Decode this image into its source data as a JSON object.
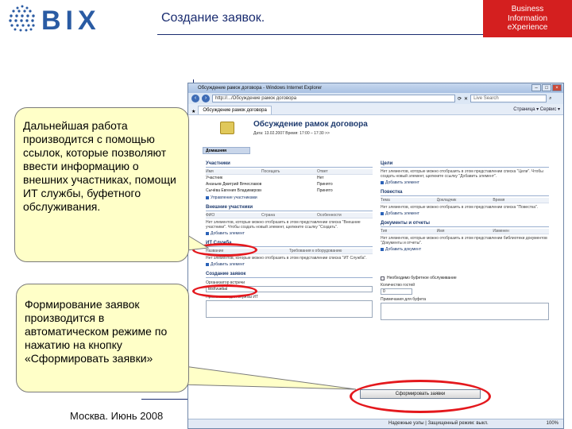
{
  "slide": {
    "logo_text": "BIX",
    "title": "Создание заявок.",
    "brand_lines": [
      "Business",
      "Information",
      "eXperience"
    ],
    "footer": "Москва. Июнь 2008",
    "brand_color": "#d41f1f",
    "accent_color": "#2a5ba3"
  },
  "callouts": [
    "Дальнейшая работа производится с помощью ссылок, которые позволяют ввести информацию о внешних участниках, помощи ИТ службы, буфетного обслуживания.",
    "Формирование заявок производится в автоматическом режиме по нажатию на кнопку «Сформировать заявки»"
  ],
  "browser": {
    "window_title": "Обсуждение рамок договора - Windows Internet Explorer",
    "address": "http://.../Обсуждение рамок договора",
    "search_placeholder": "Live Search",
    "tab": "Обсуждение рамок договора",
    "tools": "Страница ▾  Сервис ▾",
    "page": {
      "title": "Обсуждение рамок договора",
      "date_line": "Дата: 13.02.2007  Время: 17:00 – 17:30  >>",
      "home_tab": "Домашняя",
      "participants": {
        "title": "Участники",
        "headers": [
          "Имя",
          "Посещать",
          "Ответ"
        ],
        "rows": [
          [
            "Участник",
            "",
            "Нет"
          ],
          [
            "Ананьев Дмитрий Вячеславович",
            "",
            "Принято"
          ],
          [
            "Сычёва Евгения Владимировна",
            "",
            "Принято"
          ]
        ],
        "manage": "Управление участниками"
      },
      "external": {
        "title": "Внешние участники",
        "headers": [
          "ФИО",
          "Страна",
          "Особенности"
        ],
        "note": "Нет элементов, которые можно отобразить в этом представлении списка \"Внешние участники\". Чтобы создать новый элемент, щелкните ссылку \"Создать\".",
        "add": "Добавить элемент"
      },
      "it": {
        "title": "ИТ Служба",
        "headers": [
          "Название",
          "Требования к оборудованию"
        ],
        "note": "Нет элементов, которые можно отобразить в этом представлении списка \"ИТ Служба\".",
        "add": "Добавить элемент"
      },
      "create": {
        "title": "Создание заявок",
        "organizer_label": "Организатор встречи",
        "organizer_value": "test\\vuebal",
        "it_notes_label": "Примечания для службы ИТ",
        "catering_check": "Необходимо буфетное обслуживание",
        "guests_label": "Количество гостей",
        "guests_value": "0",
        "catering_notes_label": "Примечания для буфета",
        "button": "Сформировать заявки"
      },
      "goals": {
        "title": "Цели",
        "note": "Нет элементов, которые можно отобразить в этом представлении списка \"Цели\". Чтобы создать новый элемент, щелкните ссылку \"Добавить элемент\".",
        "add": "Добавить элемент"
      },
      "agenda": {
        "title": "Повестка",
        "headers": [
          "Тема",
          "Докладчик",
          "Время"
        ],
        "note": "Нет элементов, которые можно отобразить в этом представлении списка \"Повестка\".",
        "add": "Добавить элемент"
      },
      "docs": {
        "title": "Документы и отчеты",
        "headers": [
          "Тип",
          "Имя",
          "Изменен"
        ],
        "note": "Нет элементов, которые можно отобразить в этом представлении библиотеки документов \"Документы и отчеты\".",
        "add": "Добавить документ"
      }
    },
    "status": "Надежные узлы | Защищенный режим: выкл.",
    "zoom": "100%"
  }
}
